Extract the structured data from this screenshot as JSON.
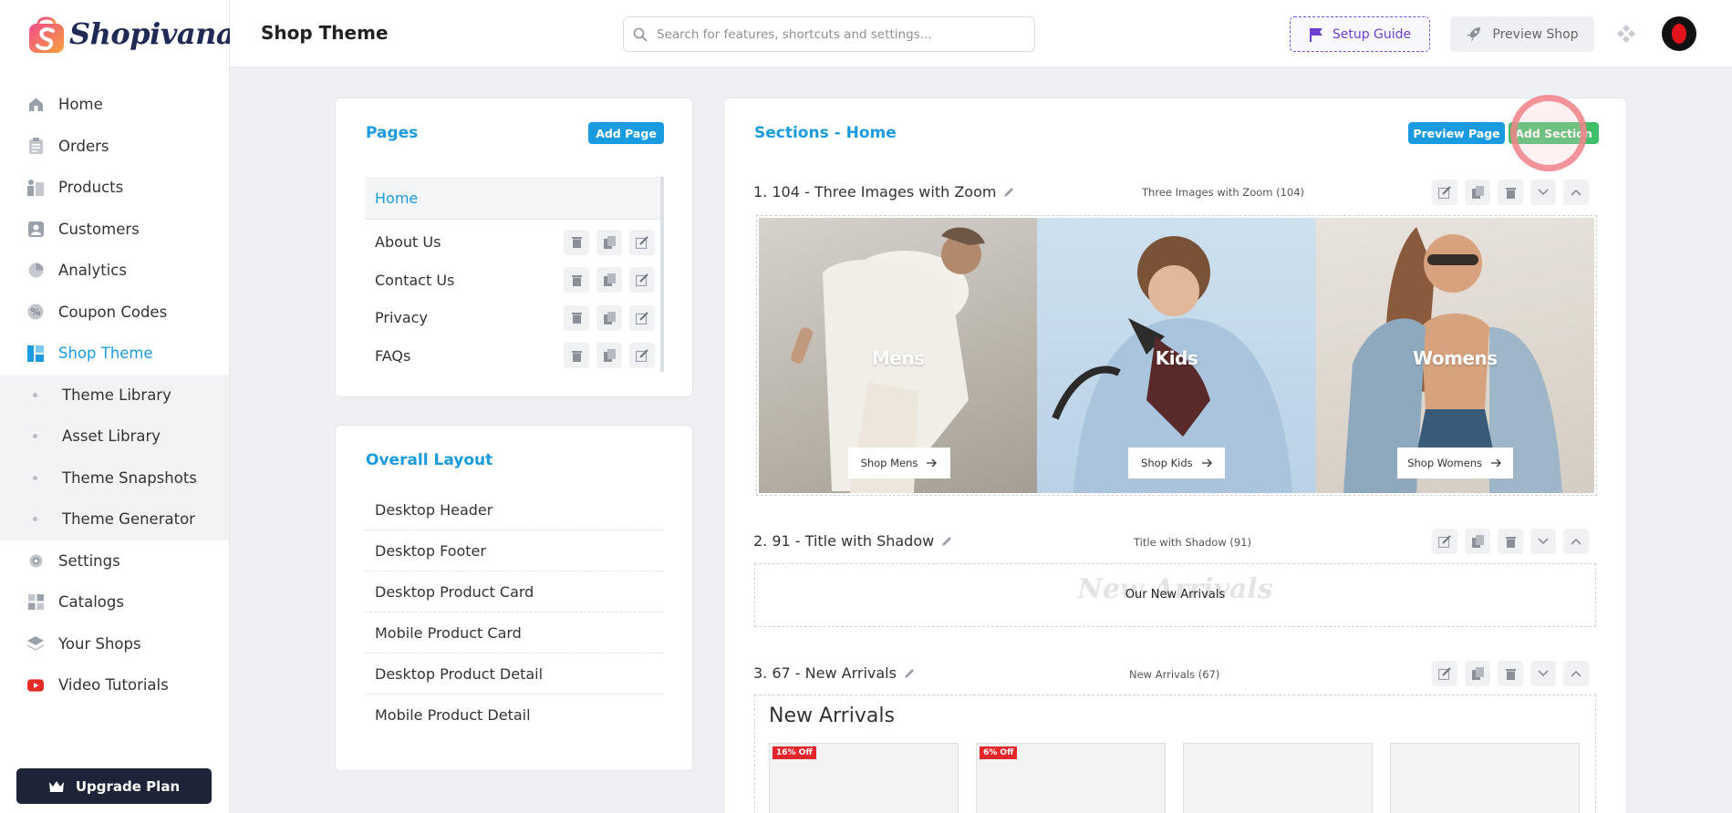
{
  "brand": {
    "name": "Shopivana"
  },
  "sidebar": {
    "items": [
      {
        "label": "Home",
        "icon": "home-icon"
      },
      {
        "label": "Orders",
        "icon": "clipboard-icon"
      },
      {
        "label": "Products",
        "icon": "products-icon"
      },
      {
        "label": "Customers",
        "icon": "user-card-icon"
      },
      {
        "label": "Analytics",
        "icon": "pie-chart-icon"
      },
      {
        "label": "Coupon Codes",
        "icon": "percent-badge-icon"
      },
      {
        "label": "Shop Theme",
        "icon": "layout-icon",
        "active": true
      }
    ],
    "subitems": [
      {
        "label": "Theme Library"
      },
      {
        "label": "Asset Library"
      },
      {
        "label": "Theme Snapshots"
      },
      {
        "label": "Theme Generator"
      }
    ],
    "items_after": [
      {
        "label": "Settings",
        "icon": "gear-icon"
      },
      {
        "label": "Catalogs",
        "icon": "grid-icon"
      },
      {
        "label": "Your Shops",
        "icon": "layers-icon"
      },
      {
        "label": "Video Tutorials",
        "icon": "youtube-icon"
      }
    ],
    "upgrade_label": "Upgrade Plan"
  },
  "header": {
    "title": "Shop Theme",
    "search_placeholder": "Search for features, shortcuts and settings...",
    "setup_guide_label": "Setup Guide",
    "preview_shop_label": "Preview Shop"
  },
  "pages_card": {
    "title": "Pages",
    "add_label": "Add Page",
    "items": [
      {
        "label": "Home",
        "active": true
      },
      {
        "label": "About Us"
      },
      {
        "label": "Contact Us"
      },
      {
        "label": "Privacy"
      },
      {
        "label": "FAQs"
      }
    ]
  },
  "layout_card": {
    "title": "Overall Layout",
    "items": [
      "Desktop Header",
      "Desktop Footer",
      "Desktop Product Card",
      "Mobile Product Card",
      "Desktop Product Detail",
      "Mobile Product Detail"
    ]
  },
  "sections_card": {
    "title": "Sections - Home",
    "preview_label": "Preview Page",
    "add_label": "Add Section",
    "sections": [
      {
        "heading": "1. 104 - Three Images with Zoom",
        "meta": "Three Images with Zoom (104)"
      },
      {
        "heading": "2. 91 - Title with Shadow",
        "meta": "Title with Shadow (91)"
      },
      {
        "heading": "3. 67 - New Arrivals",
        "meta": "New Arrivals (67)"
      }
    ],
    "banner": [
      {
        "label": "Mens",
        "button": "Shop Mens"
      },
      {
        "label": "Kids",
        "button": "Shop Kids"
      },
      {
        "label": "Womens",
        "button": "Shop Womens"
      }
    ],
    "shadow_title": {
      "shadow": "New Arrivals",
      "main": "Our New Arrivals"
    },
    "arrivals": {
      "title": "New Arrivals",
      "badges": [
        "16% Off",
        "6% Off"
      ]
    }
  },
  "colors": {
    "accent": "#1a9be0",
    "green": "#3fbf6a",
    "dark": "#1d2438",
    "purple": "#6b3fd0"
  }
}
